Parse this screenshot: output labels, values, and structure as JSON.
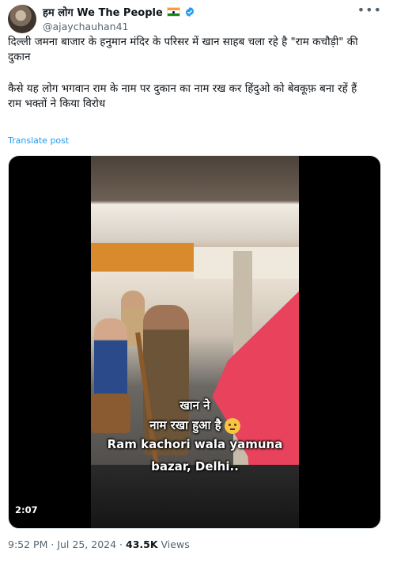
{
  "author": {
    "display_name": "हम लोग We The People",
    "handle": "@ajaychauhan41",
    "flag_icon": "india-flag",
    "verified": true
  },
  "tweet": {
    "line1": "दिल्ली जमना बाजार के हनुमान मंदिर के परिसर में खान साहब चला रहे है \"राम कचौड़ी\" की दुकान",
    "line2": "कैसे यह लोग भगवान राम के नाम पर दुकान का नाम रख कर हिंदुओ को बेवकूफ़ बना रहें हैं",
    "line3": "राम भक्तों ने किया विरोध",
    "translate_label": "Translate post"
  },
  "video": {
    "duration": "2:07",
    "caption_line1": "खान ने",
    "caption_line2": "नाम रखा हुआ है",
    "caption_line3": "Ram kachori wala  yamuna",
    "caption_line4": "bazar, Delhi..",
    "emoji": "thinking-face"
  },
  "meta": {
    "time": "9:52 PM",
    "date": "Jul 25, 2024",
    "separator": "·",
    "views_count": "43.5K",
    "views_label": "Views"
  },
  "colors": {
    "link": "#1d9bf0",
    "text": "#0f1419",
    "muted": "#536471",
    "verified": "#1d9bf0"
  }
}
